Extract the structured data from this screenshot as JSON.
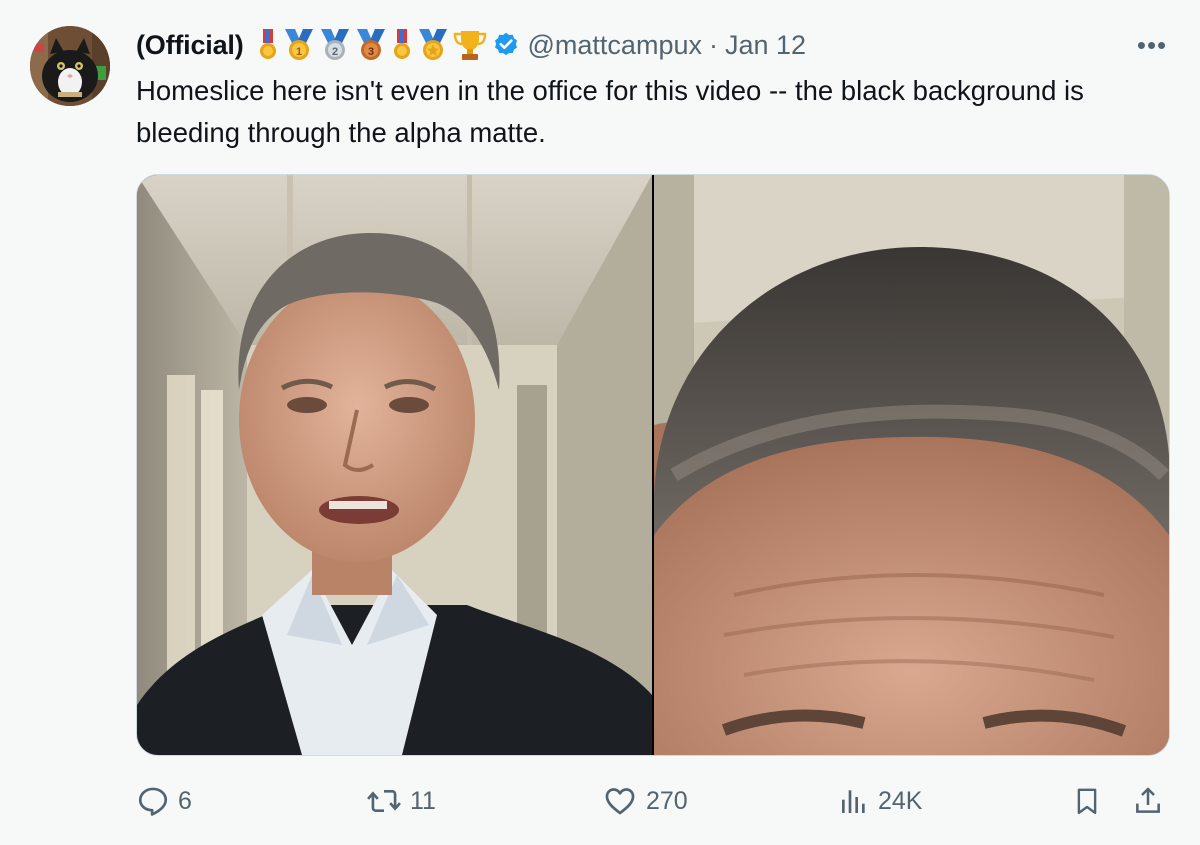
{
  "tweet": {
    "author_name": "(Official)",
    "handle": "@mattcampux",
    "separator": "·",
    "date": "Jan 12",
    "more_label": "•••",
    "text": "Homeslice here isn't even in the office for this video -- the black background is bleeding through the alpha matte.",
    "badges": [
      "medal-icon",
      "gold-medal-1-icon",
      "silver-medal-2-icon",
      "bronze-medal-3-icon",
      "medal-icon",
      "sports-medal-icon",
      "trophy-icon"
    ],
    "verified": true
  },
  "actions": {
    "replies": "6",
    "reposts": "11",
    "likes": "270",
    "views": "24K"
  },
  "colors": {
    "text_primary": "#0f1419",
    "text_secondary": "#536471",
    "verified_blue": "#1d9bf0",
    "background": "#f7f9f9"
  }
}
